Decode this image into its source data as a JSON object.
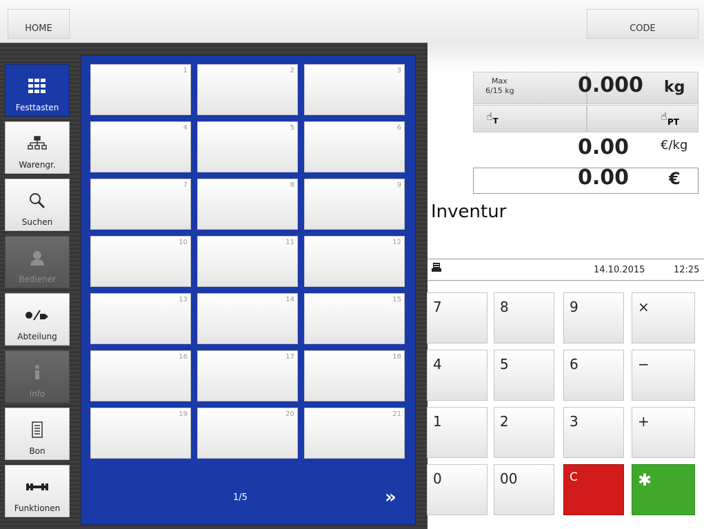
{
  "header": {
    "home_label": "HOME",
    "code_label": "CODE"
  },
  "sidebar": {
    "items": [
      {
        "label": "Festtasten",
        "icon": "grid-icon",
        "state": "active"
      },
      {
        "label": "Warengr.",
        "icon": "hierarchy-icon",
        "state": "normal"
      },
      {
        "label": "Suchen",
        "icon": "search-icon",
        "state": "normal"
      },
      {
        "label": "Bediener",
        "icon": "user-icon",
        "state": "disabled"
      },
      {
        "label": "Abteilung",
        "icon": "department-icon",
        "state": "normal"
      },
      {
        "label": "Info",
        "icon": "info-icon",
        "state": "disabled"
      },
      {
        "label": "Bon",
        "icon": "receipt-icon",
        "state": "normal"
      },
      {
        "label": "Funktionen",
        "icon": "wrench-icon",
        "state": "normal"
      }
    ]
  },
  "keys": {
    "numbers": [
      "1",
      "2",
      "3",
      "4",
      "5",
      "6",
      "7",
      "8",
      "9",
      "10",
      "11",
      "12",
      "13",
      "14",
      "15",
      "16",
      "17",
      "18",
      "19",
      "20",
      "21"
    ],
    "page": "1/5",
    "next_icon": "double-chevron-right-icon"
  },
  "scale": {
    "max_label": "Max",
    "range_label": "6/15 kg",
    "weight": "0.000",
    "weight_unit": "kg",
    "tare_label": "T",
    "preset_tare_label": "PT",
    "unit_price": "0.00",
    "unit_price_unit": "€/kg",
    "total": "0.00",
    "total_unit": "€"
  },
  "mode": {
    "title": "Inventur"
  },
  "status": {
    "date": "14.10.2015",
    "time": "12:25",
    "icon": "printer-icon"
  },
  "numpad": {
    "keys": [
      "7",
      "8",
      "9",
      "×",
      "4",
      "5",
      "6",
      "−",
      "1",
      "2",
      "3",
      "+",
      "0",
      "00",
      "C",
      "✱"
    ]
  },
  "colors": {
    "accent_blue": "#1a3aa8",
    "clear_red": "#d21b1b",
    "enter_green": "#3fa82a"
  }
}
